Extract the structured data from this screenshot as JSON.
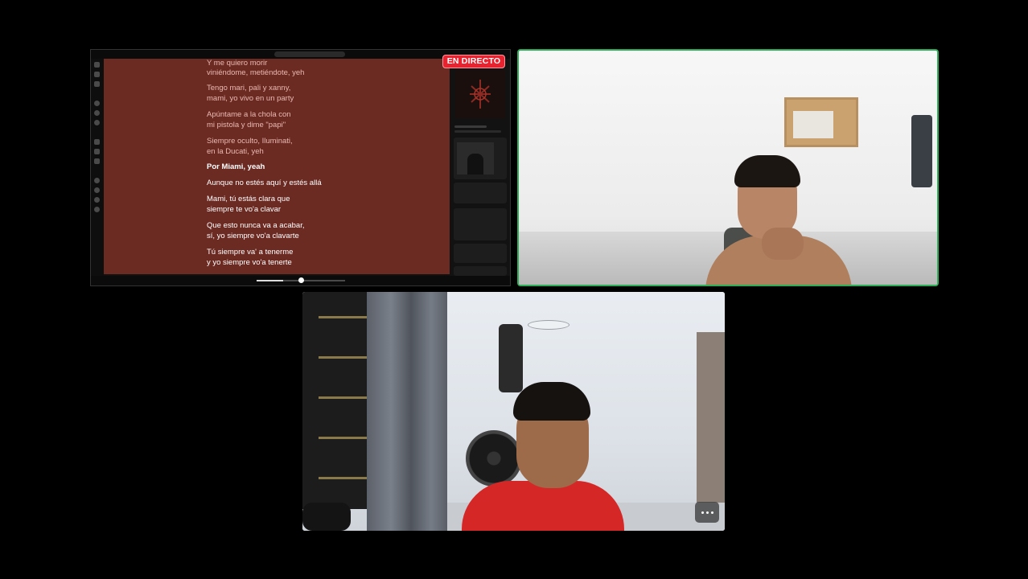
{
  "screen_share": {
    "live_badge": "EN DIRECTO",
    "lyrics": [
      {
        "text": "Y me quiero morir",
        "state": "past"
      },
      {
        "text": "viniéndome, metiéndote, yeh",
        "state": "past"
      },
      {
        "text": "Tengo mari, pali y xanny,",
        "state": "past"
      },
      {
        "text": "mami, yo vivo en un party",
        "state": "past"
      },
      {
        "text": "Apúntame a la chola con",
        "state": "past"
      },
      {
        "text": "mi pistola y dime \"papi\"",
        "state": "past"
      },
      {
        "text": "Siempre oculto, Iluminati,",
        "state": "past"
      },
      {
        "text": "en la Ducati, yeh",
        "state": "past"
      },
      {
        "text": "Por Miami, yeah",
        "state": "active"
      },
      {
        "text": "Aunque no estés aquí y estés allá",
        "state": "upcoming"
      },
      {
        "text": "Mami, tú estás clara que",
        "state": "upcoming"
      },
      {
        "text": "siempre te vo'a clavar",
        "state": "upcoming"
      },
      {
        "text": "Que esto nunca va a acabar,",
        "state": "upcoming"
      },
      {
        "text": "sí, yo siempre vo'a clavarte",
        "state": "upcoming"
      },
      {
        "text": "Tú siempre va' a tenerme",
        "state": "upcoming"
      },
      {
        "text": "y yo siempre vo'a tenerte",
        "state": "upcoming"
      }
    ]
  },
  "participants": {
    "top_right_active_speaker": true,
    "more_options_label": "more options"
  },
  "colors": {
    "lyrics_bg": "#6b2a22",
    "live_badge": "#e8232f",
    "active_speaker_border": "#2fae58"
  }
}
